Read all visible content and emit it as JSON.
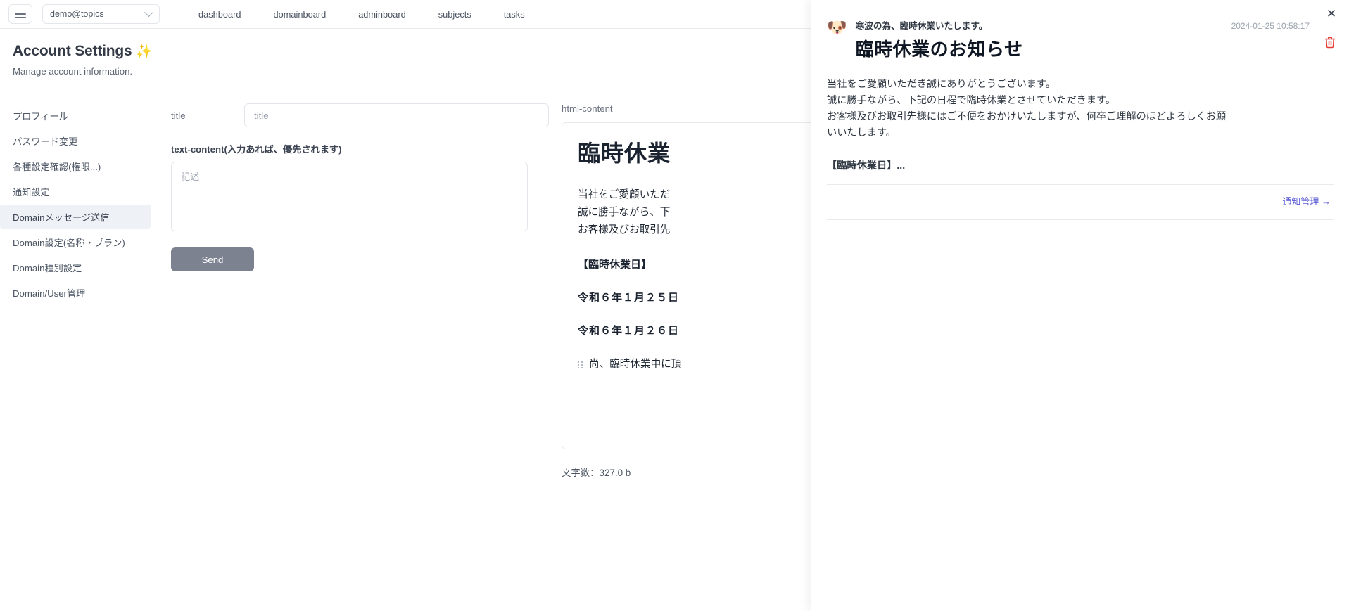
{
  "topbar": {
    "menu_icon": "hamburger-icon",
    "domain_value": "demo@topics",
    "chevron_icon": "chevron-down-icon",
    "tabs": [
      {
        "label": "dashboard"
      },
      {
        "label": "domainboard"
      },
      {
        "label": "adminboard"
      },
      {
        "label": "subjects"
      },
      {
        "label": "tasks"
      }
    ]
  },
  "page": {
    "title": "Account Settings",
    "title_emoji": "✨",
    "subtitle": "Manage account information."
  },
  "sidebar": {
    "items": [
      {
        "label": "プロフィール",
        "active": false
      },
      {
        "label": "パスワード変更",
        "active": false
      },
      {
        "label": "各種設定確認(権限...)",
        "active": false
      },
      {
        "label": "通知設定",
        "active": false
      },
      {
        "label": "Domainメッセージ送信",
        "active": true
      },
      {
        "label": "Domain設定(名称・プラン)",
        "active": false
      },
      {
        "label": "Domain種別設定",
        "active": false
      },
      {
        "label": "Domain/User管理",
        "active": false
      }
    ]
  },
  "form": {
    "title_label": "title",
    "title_value": "",
    "title_placeholder": "title",
    "text_label": "text-content(入力あれば、優先されます)",
    "text_value": "",
    "text_placeholder": "記述",
    "send_label": "Send"
  },
  "preview": {
    "label": "html-content",
    "heading": "臨時休業",
    "paragraphs": [
      "当社をご愛顧いただ",
      "誠に勝手ながら、下",
      "お客様及びお取引先"
    ],
    "section": "【臨時休業日】",
    "dates": [
      "令和６年１月２５日",
      "令和６年１月２６日"
    ],
    "last_line": "尚、臨時休業中に頂",
    "drag_handle_icon": "drag-handle-icon",
    "bytes_label": "文字数：327.0 b"
  },
  "notification": {
    "close_icon": "close-icon",
    "avatar_icon": "dog-avatar-icon",
    "avatar_glyph": "🐶",
    "subject": "寒波の為、臨時休業いたします。",
    "title": "臨時休業のお知らせ",
    "timestamp": "2024-01-25 10:58:17",
    "trash_icon": "trash-icon",
    "trash_color": "#e53935",
    "body_lines": [
      "当社をご愛顧いただき誠にありがとうございます。",
      "誠に勝手ながら、下記の日程で臨時休業とさせていただきます。",
      "お客様及びお取引先様にはご不便をおかけいたしますが、何卒ご理解のほどよろしくお願",
      "いいたします。"
    ],
    "more_text": "【臨時休業日】...",
    "manage_link": "通知管理 →",
    "link_color": "#5b5bd6"
  }
}
